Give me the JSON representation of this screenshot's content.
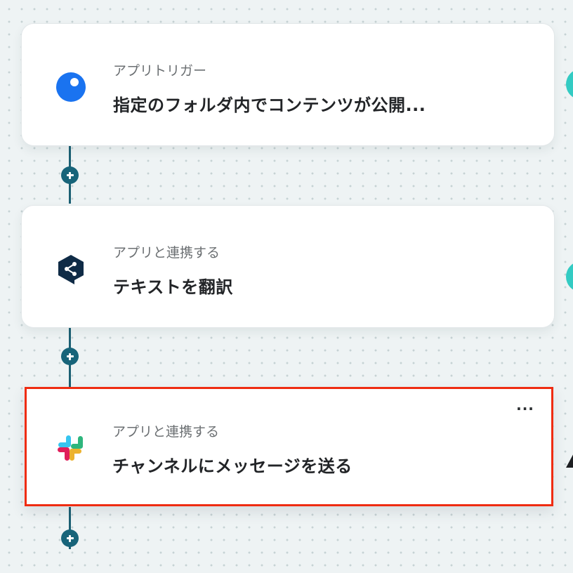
{
  "workflow": {
    "steps": [
      {
        "subtitle": "アプリトリガー",
        "title": "指定のフォルダ内でコンテンツが公開...",
        "icon": "blue-circle-app-icon",
        "color": "#1a73f0"
      },
      {
        "subtitle": "アプリと連携する",
        "title": "テキストを翻訳",
        "icon": "deepl-icon",
        "color": "#0f2b46"
      },
      {
        "subtitle": "アプリと連携する",
        "title": "チャンネルにメッセージを送る",
        "icon": "slack-icon",
        "selected": true
      }
    ],
    "more_label": "···"
  },
  "colors": {
    "connector": "#1b5f73",
    "add_button": "#17647a",
    "selection_border": "#ef2c11",
    "side_accent": "#33cbc3"
  }
}
